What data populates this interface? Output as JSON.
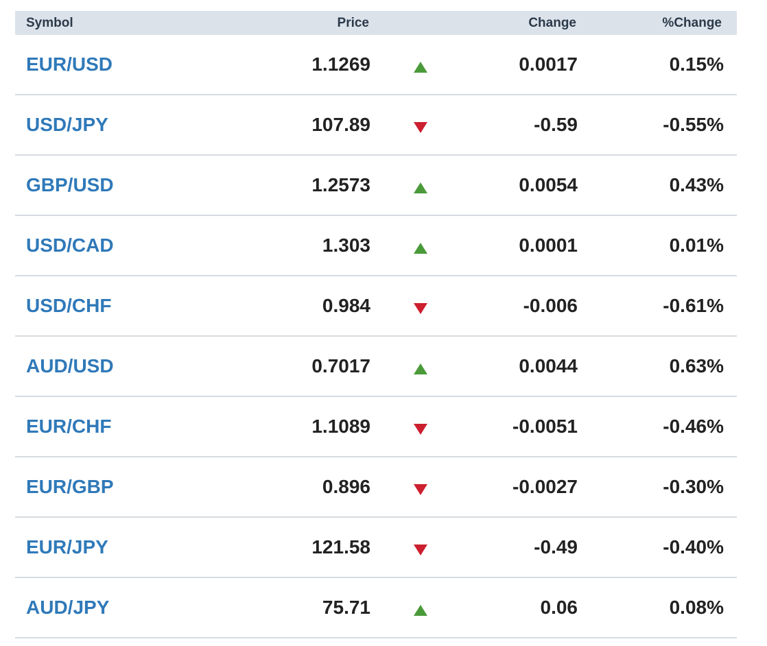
{
  "header": {
    "symbol": "Symbol",
    "price": "Price",
    "change": "Change",
    "pct_change": "%Change"
  },
  "colors": {
    "up": "#4a9a3a",
    "down": "#cc1f2f",
    "symbol_link": "#2f79b9"
  },
  "icons": {
    "up": "triangle-up-icon",
    "down": "triangle-down-icon"
  },
  "rows": [
    {
      "symbol": "EUR/USD",
      "price": "1.1269",
      "dir": "up",
      "change": "0.0017",
      "pct": "0.15%"
    },
    {
      "symbol": "USD/JPY",
      "price": "107.89",
      "dir": "down",
      "change": "-0.59",
      "pct": "-0.55%"
    },
    {
      "symbol": "GBP/USD",
      "price": "1.2573",
      "dir": "up",
      "change": "0.0054",
      "pct": "0.43%"
    },
    {
      "symbol": "USD/CAD",
      "price": "1.303",
      "dir": "up",
      "change": "0.0001",
      "pct": "0.01%"
    },
    {
      "symbol": "USD/CHF",
      "price": "0.984",
      "dir": "down",
      "change": "-0.006",
      "pct": "-0.61%"
    },
    {
      "symbol": "AUD/USD",
      "price": "0.7017",
      "dir": "up",
      "change": "0.0044",
      "pct": "0.63%"
    },
    {
      "symbol": "EUR/CHF",
      "price": "1.1089",
      "dir": "down",
      "change": "-0.0051",
      "pct": "-0.46%"
    },
    {
      "symbol": "EUR/GBP",
      "price": "0.896",
      "dir": "down",
      "change": "-0.0027",
      "pct": "-0.30%"
    },
    {
      "symbol": "EUR/JPY",
      "price": "121.58",
      "dir": "down",
      "change": "-0.49",
      "pct": "-0.40%"
    },
    {
      "symbol": "AUD/JPY",
      "price": "75.71",
      "dir": "up",
      "change": "0.06",
      "pct": "0.08%"
    }
  ]
}
